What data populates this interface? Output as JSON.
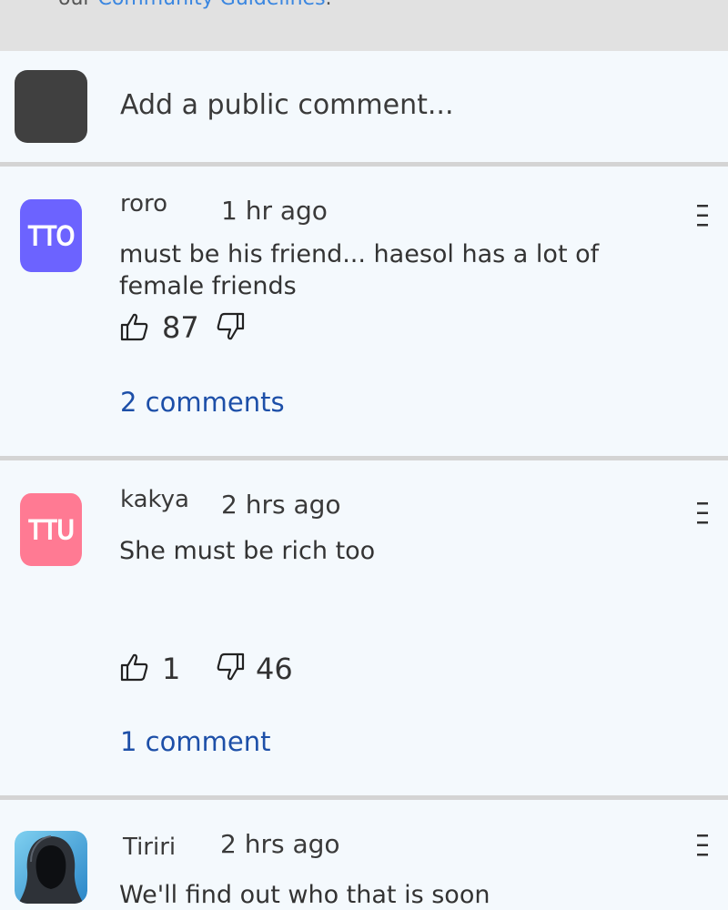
{
  "notice": {
    "prefix": "our ",
    "link": "Community Guidelines",
    "suffix": "."
  },
  "composer": {
    "placeholder": "Add a public comment..."
  },
  "comments": [
    {
      "avatar_text": "TTO",
      "avatar_color": "#6c63ff",
      "username": "roro",
      "time": "1 hr ago",
      "text": "must be his friend... haesol has a lot of female friends",
      "likes": "87",
      "dislikes": "",
      "replies": "2 comments"
    },
    {
      "avatar_text": "TTU",
      "avatar_color": "#ff7a93",
      "username": "kakya",
      "time": "2 hrs ago",
      "text": "She must be rich too",
      "likes": "1",
      "dislikes": "46",
      "replies": "1 comment"
    },
    {
      "avatar_icon": "hooded-figure-icon",
      "username": "Tiriri",
      "time": "2 hrs ago",
      "text": "We'll find out who that is soon"
    }
  ],
  "colors": {
    "link": "#3a86e0",
    "replies": "#1d4fa8",
    "background": "#f4f9fd",
    "notice_background": "#e1e1e1"
  }
}
